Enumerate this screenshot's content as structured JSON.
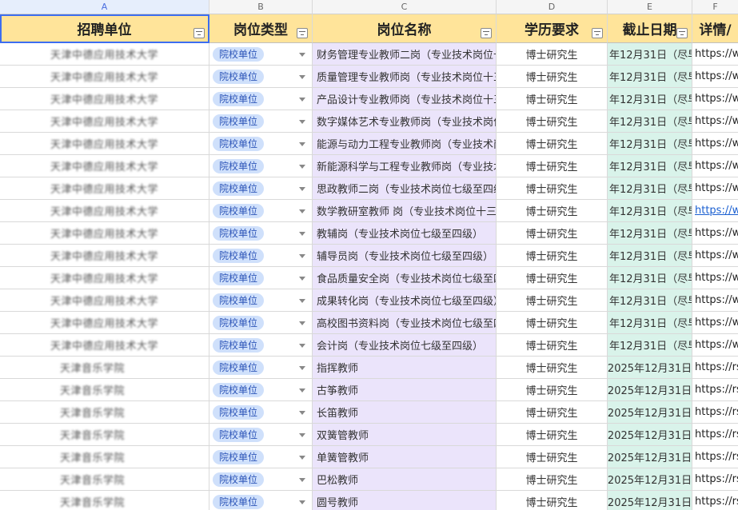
{
  "columns": [
    "A",
    "B",
    "C",
    "D",
    "E",
    "F"
  ],
  "headers": [
    "招聘单位",
    "岗位类型",
    "岗位名称",
    "学历要求",
    "截止日期",
    "详情/"
  ],
  "rows": [
    {
      "unit": "天津中德应用技术大学",
      "type": "院校单位",
      "name": "财务管理专业教师二岗（专业技术岗位十",
      "edu": "博士研究生",
      "deadline": "年12月31日（尽早",
      "detail": "https://w"
    },
    {
      "unit": "天津中德应用技术大学",
      "type": "院校单位",
      "name": "质量管理专业教师岗（专业技术岗位十三",
      "edu": "博士研究生",
      "deadline": "年12月31日（尽早",
      "detail": "https://w"
    },
    {
      "unit": "天津中德应用技术大学",
      "type": "院校单位",
      "name": "产品设计专业教师岗（专业技术岗位十三",
      "edu": "博士研究生",
      "deadline": "年12月31日（尽早",
      "detail": "https://w"
    },
    {
      "unit": "天津中德应用技术大学",
      "type": "院校单位",
      "name": "数字媒体艺术专业教师岗（专业技术岗位",
      "edu": "博士研究生",
      "deadline": "年12月31日（尽早",
      "detail": "https://w"
    },
    {
      "unit": "天津中德应用技术大学",
      "type": "院校单位",
      "name": "能源与动力工程专业教师岗（专业技术岗",
      "edu": "博士研究生",
      "deadline": "年12月31日（尽早",
      "detail": "https://w"
    },
    {
      "unit": "天津中德应用技术大学",
      "type": "院校单位",
      "name": "新能源科学与工程专业教师岗（专业技术",
      "edu": "博士研究生",
      "deadline": "年12月31日（尽早",
      "detail": "https://w"
    },
    {
      "unit": "天津中德应用技术大学",
      "type": "院校单位",
      "name": "思政教师二岗（专业技术岗位七级至四级",
      "edu": "博士研究生",
      "deadline": "年12月31日（尽早",
      "detail": "https://w"
    },
    {
      "unit": "天津中德应用技术大学",
      "type": "院校单位",
      "name": "数学教研室教师 岗（专业技术岗位十三",
      "edu": "博士研究生",
      "deadline": "年12月31日（尽早",
      "detail": "https://w"
    },
    {
      "unit": "天津中德应用技术大学",
      "type": "院校单位",
      "name": "教辅岗（专业技术岗位七级至四级）",
      "edu": "博士研究生",
      "deadline": "年12月31日（尽早",
      "detail": "https://w"
    },
    {
      "unit": "天津中德应用技术大学",
      "type": "院校单位",
      "name": "辅导员岗（专业技术岗位七级至四级）",
      "edu": "博士研究生",
      "deadline": "年12月31日（尽早",
      "detail": "https://w"
    },
    {
      "unit": "天津中德应用技术大学",
      "type": "院校单位",
      "name": "食品质量安全岗（专业技术岗位七级至四",
      "edu": "博士研究生",
      "deadline": "年12月31日（尽早",
      "detail": "https://w"
    },
    {
      "unit": "天津中德应用技术大学",
      "type": "院校单位",
      "name": "成果转化岗（专业技术岗位七级至四级）",
      "edu": "博士研究生",
      "deadline": "年12月31日（尽早",
      "detail": "https://w"
    },
    {
      "unit": "天津中德应用技术大学",
      "type": "院校单位",
      "name": "高校图书资料岗（专业技术岗位七级至四",
      "edu": "博士研究生",
      "deadline": "年12月31日（尽早",
      "detail": "https://w"
    },
    {
      "unit": "天津中德应用技术大学",
      "type": "院校单位",
      "name": "会计岗（专业技术岗位七级至四级）",
      "edu": "博士研究生",
      "deadline": "年12月31日（尽早",
      "detail": "https://w"
    },
    {
      "unit": "天津音乐学院",
      "type": "院校单位",
      "name": "指挥教师",
      "edu": "博士研究生",
      "deadline": "2025年12月31日",
      "detail": "https://rs"
    },
    {
      "unit": "天津音乐学院",
      "type": "院校单位",
      "name": "古筝教师",
      "edu": "博士研究生",
      "deadline": "2025年12月31日",
      "detail": "https://rs"
    },
    {
      "unit": "天津音乐学院",
      "type": "院校单位",
      "name": "长笛教师",
      "edu": "博士研究生",
      "deadline": "2025年12月31日",
      "detail": "https://rs"
    },
    {
      "unit": "天津音乐学院",
      "type": "院校单位",
      "name": "双簧管教师",
      "edu": "博士研究生",
      "deadline": "2025年12月31日",
      "detail": "https://rs"
    },
    {
      "unit": "天津音乐学院",
      "type": "院校单位",
      "name": "单簧管教师",
      "edu": "博士研究生",
      "deadline": "2025年12月31日",
      "detail": "https://rs"
    },
    {
      "unit": "天津音乐学院",
      "type": "院校单位",
      "name": "巴松教师",
      "edu": "博士研究生",
      "deadline": "2025年12月31日",
      "detail": "https://rs"
    },
    {
      "unit": "天津音乐学院",
      "type": "院校单位",
      "name": "圆号教师",
      "edu": "博士研究生",
      "deadline": "2025年12月31日",
      "detail": "https://rs"
    }
  ],
  "linked_row": 7,
  "colors": {
    "header": "#ffe49a",
    "name_col": "#ebe4fb",
    "date_col": "#d9f3ea",
    "tag": "#cfe0fb"
  }
}
